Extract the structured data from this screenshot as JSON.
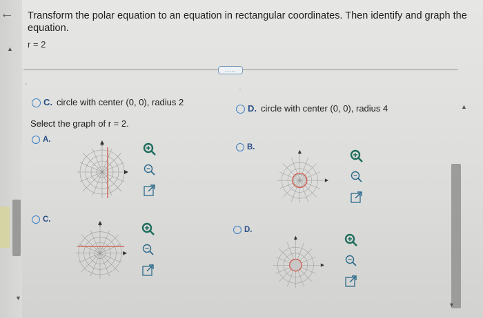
{
  "question": {
    "prompt": "Transform the polar equation to an equation in rectangular coordinates. Then identify and graph the equation.",
    "equation": "r = 2"
  },
  "choices": {
    "c": {
      "letter": "C.",
      "text": "circle with center (0, 0), radius 2"
    },
    "d": {
      "letter": "D.",
      "text": "circle with center (0, 0), radius 4"
    }
  },
  "select_graph": "Select the graph of r = 2.",
  "graph_options": [
    {
      "letter": "A."
    },
    {
      "letter": "B."
    },
    {
      "letter": "C."
    },
    {
      "letter": "D."
    }
  ],
  "divider_label": "....."
}
